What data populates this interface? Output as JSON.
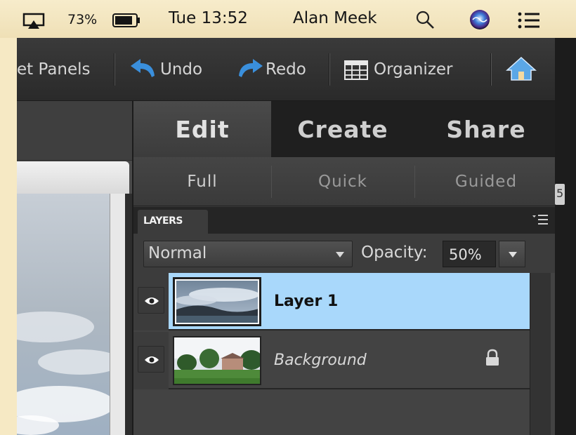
{
  "menubar": {
    "battery_percent": "73%",
    "clock": "Tue 13:52",
    "user": "Alan Meek"
  },
  "toolbar": {
    "reset_panels_label": "et Panels",
    "undo_label": "Undo",
    "redo_label": "Redo",
    "organizer_label": "Organizer"
  },
  "tabs": {
    "edit": "Edit",
    "create": "Create",
    "share": "Share"
  },
  "subtabs": {
    "full": "Full",
    "quick": "Quick",
    "guided": "Guided"
  },
  "layers_panel": {
    "title": "LAYERS",
    "blend_mode": "Normal",
    "opacity_label": "Opacity:",
    "opacity_value": "50%",
    "layers": [
      {
        "name": "Layer 1",
        "selected": true
      },
      {
        "name": "Background",
        "locked": true
      }
    ]
  },
  "edge_badge": "5",
  "colors": {
    "selection": "#a9d8fb",
    "undo_icon": "#3a8fdc",
    "redo_icon": "#3a8fdc",
    "desktop": "#f6e9c4"
  },
  "icons": [
    "airplay-icon",
    "battery-icon",
    "search-icon",
    "siri-icon",
    "notification-center-icon",
    "undo-icon",
    "redo-icon",
    "organizer-icon",
    "home-icon",
    "eye-icon",
    "lock-icon",
    "panel-menu-icon"
  ]
}
